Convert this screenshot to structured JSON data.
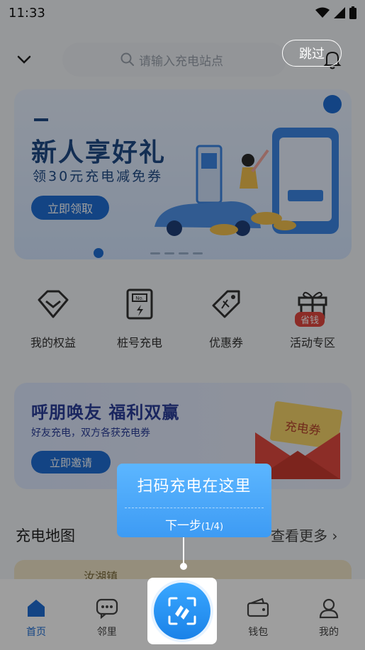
{
  "status": {
    "time": "11:33"
  },
  "search": {
    "placeholder": "请输入充电站点"
  },
  "skip": "跳过",
  "banner": {
    "title": "新人享好礼",
    "subtitle": "领30元充电减免券",
    "button": "立即领取"
  },
  "quick": [
    {
      "label": "我的权益",
      "icon": "diamond-icon"
    },
    {
      "label": "桩号充电",
      "icon": "charger-icon"
    },
    {
      "label": "优惠券",
      "icon": "coupon-tag-icon"
    },
    {
      "label": "活动专区",
      "icon": "gift-icon",
      "tag": "省钱"
    }
  ],
  "invite": {
    "title": "呼朋唤友  福利双赢",
    "subtitle": "好友充电，双方各获充电券",
    "button": "立即邀请",
    "coupon": "充电券"
  },
  "map": {
    "title": "充电地图",
    "more": "查看更多",
    "place": "汝湖镇"
  },
  "tooltip": {
    "title": "扫码充电在这里",
    "next": "下一步",
    "step": "(1/4)"
  },
  "tabs": [
    {
      "label": "首页",
      "icon": "home-icon",
      "active": true
    },
    {
      "label": "邻里",
      "icon": "chat-icon",
      "active": false
    },
    {
      "label": "",
      "icon": "scan-icon",
      "active": false
    },
    {
      "label": "钱包",
      "icon": "wallet-icon",
      "active": false
    },
    {
      "label": "我的",
      "icon": "user-icon",
      "active": false
    }
  ],
  "colors": {
    "accent": "#1f6fd6",
    "tooltip": "#4aa8fa",
    "dim": "rgba(0,0,0,0.38)"
  }
}
